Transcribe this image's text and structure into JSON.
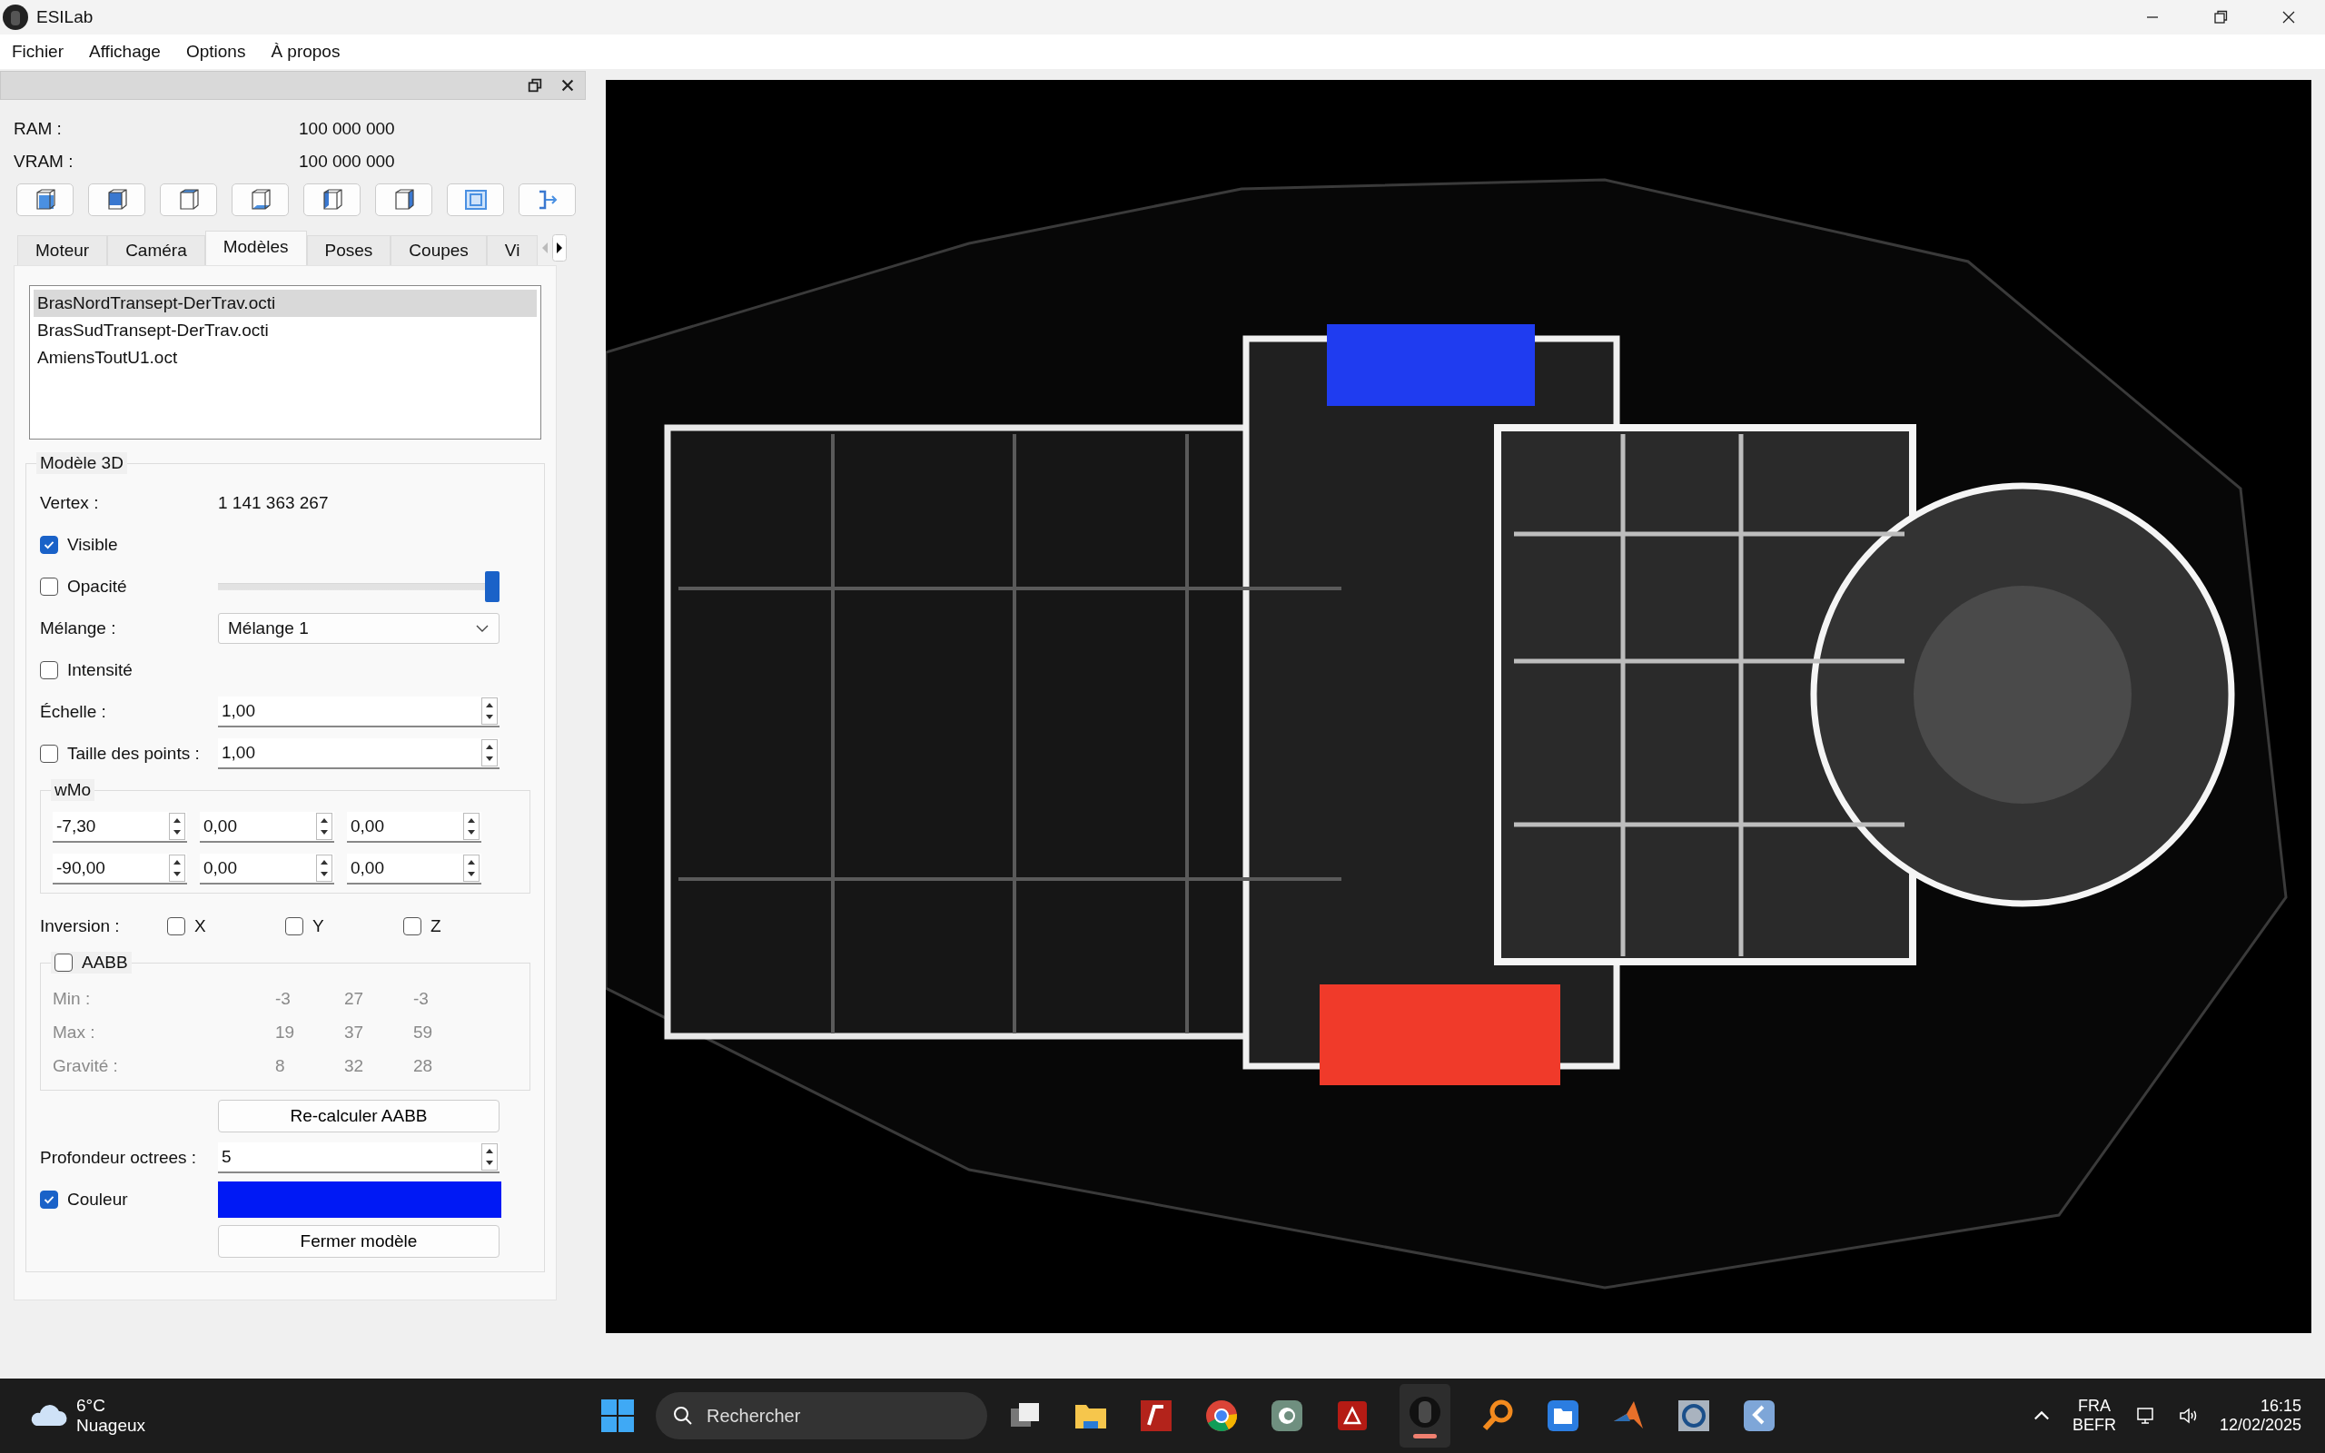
{
  "window": {
    "title": "ESILab"
  },
  "menu": [
    "Fichier",
    "Affichage",
    "Options",
    "À propos"
  ],
  "memory": [
    {
      "label": "RAM :",
      "value": "100 000 000"
    },
    {
      "label": "VRAM :",
      "value": "100 000 000"
    }
  ],
  "tabs": [
    {
      "label": "Moteur",
      "selected": false
    },
    {
      "label": "Caméra",
      "selected": false
    },
    {
      "label": "Modèles",
      "selected": true
    },
    {
      "label": "Poses",
      "selected": false
    },
    {
      "label": "Coupes",
      "selected": false
    },
    {
      "label": "Vi",
      "selected": false
    }
  ],
  "models": [
    {
      "name": "BrasNordTransept-DerTrav.octi",
      "selected": true
    },
    {
      "name": "BrasSudTransept-DerTrav.octi",
      "selected": false
    },
    {
      "name": "AmiensToutU1.oct",
      "selected": false
    }
  ],
  "model_3d": {
    "title": "Modèle 3D",
    "vertex_label": "Vertex :",
    "vertex_value": "1 141 363 267",
    "visible": {
      "label": "Visible",
      "checked": true
    },
    "opacity": {
      "label": "Opacité",
      "checked": false,
      "level": 1
    },
    "blend": {
      "label": "Mélange :",
      "value": "Mélange 1"
    },
    "intensity": {
      "label": "Intensité",
      "checked": false
    },
    "scale": {
      "label": "Échelle :",
      "value": "1,00"
    },
    "point_size": {
      "label": "Taille des points :",
      "checked": false,
      "value": "1,00"
    },
    "wmo": {
      "title": "wMo",
      "rows": [
        [
          "-7,30",
          "0,00",
          "0,00"
        ],
        [
          "-90,00",
          "0,00",
          "0,00"
        ]
      ]
    },
    "inversion": {
      "label": "Inversion :",
      "axes": [
        {
          "label": "X",
          "checked": false
        },
        {
          "label": "Y",
          "checked": false
        },
        {
          "label": "Z",
          "checked": false
        }
      ]
    },
    "aabb": {
      "label": "AABB",
      "checked": false,
      "rows": [
        {
          "label": "Min :",
          "values": [
            "-3",
            "27",
            "-3"
          ]
        },
        {
          "label": "Max :",
          "values": [
            "19",
            "37",
            "59"
          ]
        },
        {
          "label": "Gravité :",
          "values": [
            "8",
            "32",
            "28"
          ]
        }
      ]
    },
    "recalc_button": "Re-calculer AABB",
    "octree_depth": {
      "label": "Profondeur octrees :",
      "value": "5"
    },
    "color": {
      "label": "Couleur",
      "checked": true,
      "color": "#0019f5"
    },
    "close_button": "Fermer modèle"
  },
  "taskbar": {
    "temperature": "6°C",
    "weather": "Nuageux",
    "search_placeholder": "Rechercher",
    "language": "FRA",
    "layout": "BEFR",
    "time": "16:15",
    "date": "12/02/2025"
  }
}
